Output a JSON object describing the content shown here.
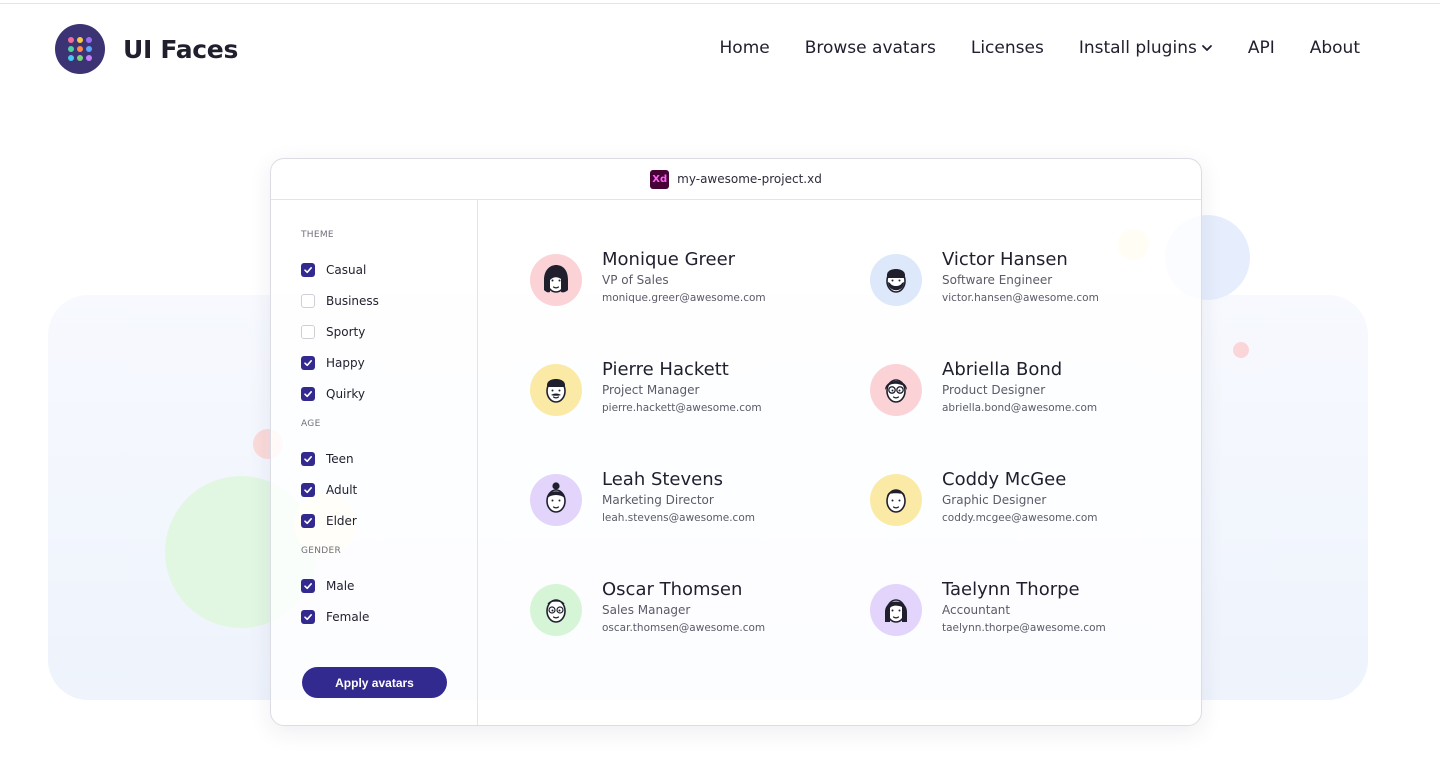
{
  "brand": {
    "name": "UI Faces",
    "logo_dot_colors": [
      "#f36b9a",
      "#f7c948",
      "#9b6cf2",
      "#4fd1a0",
      "#ff8a4c",
      "#5aa7ff",
      "#46c7f0",
      "#7ad37a",
      "#c77dff"
    ]
  },
  "nav": {
    "items": [
      {
        "label": "Home"
      },
      {
        "label": "Browse avatars"
      },
      {
        "label": "Licenses"
      },
      {
        "label": "Install plugins",
        "icon": "chevron-down-icon"
      },
      {
        "label": "API"
      },
      {
        "label": "About"
      }
    ]
  },
  "window": {
    "app_icon_label": "Xd",
    "filename": "my-awesome-project.xd"
  },
  "filters": {
    "theme": {
      "label": "THEME",
      "options": [
        {
          "label": "Casual",
          "checked": true
        },
        {
          "label": "Business",
          "checked": false
        },
        {
          "label": "Sporty",
          "checked": false
        },
        {
          "label": "Happy",
          "checked": true
        },
        {
          "label": "Quirky",
          "checked": true
        }
      ]
    },
    "age": {
      "label": "AGE",
      "options": [
        {
          "label": "Teen",
          "checked": true
        },
        {
          "label": "Adult",
          "checked": true
        },
        {
          "label": "Elder",
          "checked": true
        }
      ]
    },
    "gender": {
      "label": "GENDER",
      "options": [
        {
          "label": "Male",
          "checked": true
        },
        {
          "label": "Female",
          "checked": true
        }
      ]
    },
    "apply_label": "Apply avatars"
  },
  "people": [
    {
      "name": "Monique Greer",
      "role": "VP of Sales",
      "email": "monique.greer@awesome.com",
      "avatar_bg": "#fbd3d6",
      "avatar_icon": "woman-bob-avatar-icon"
    },
    {
      "name": "Victor Hansen",
      "role": "Software Engineer",
      "email": "victor.hansen@awesome.com",
      "avatar_bg": "#dde8fb",
      "avatar_icon": "bearded-man-avatar-icon"
    },
    {
      "name": "Pierre Hackett",
      "role": "Project Manager",
      "email": "pierre.hackett@awesome.com",
      "avatar_bg": "#fbe9a6",
      "avatar_icon": "mustache-man-avatar-icon"
    },
    {
      "name": "Abriella Bond",
      "role": "Product Designer",
      "email": "abriella.bond@awesome.com",
      "avatar_bg": "#fbd3d6",
      "avatar_icon": "glasses-woman-avatar-icon"
    },
    {
      "name": "Leah Stevens",
      "role": "Marketing Director",
      "email": "leah.stevens@awesome.com",
      "avatar_bg": "#e3d4fb",
      "avatar_icon": "bun-woman-avatar-icon"
    },
    {
      "name": "Coddy McGee",
      "role": "Graphic Designer",
      "email": "coddy.mcgee@awesome.com",
      "avatar_bg": "#fbe9a6",
      "avatar_icon": "young-man-avatar-icon"
    },
    {
      "name": "Oscar Thomsen",
      "role": "Sales Manager",
      "email": "oscar.thomsen@awesome.com",
      "avatar_bg": "#d6f5d6",
      "avatar_icon": "bald-man-avatar-icon"
    },
    {
      "name": "Taelynn Thorpe",
      "role": "Accountant",
      "email": "taelynn.thorpe@awesome.com",
      "avatar_bg": "#e3d4fb",
      "avatar_icon": "long-hair-woman-avatar-icon"
    }
  ],
  "colors": {
    "accent": "#332a8f",
    "logo_bg": "#3b3373"
  }
}
